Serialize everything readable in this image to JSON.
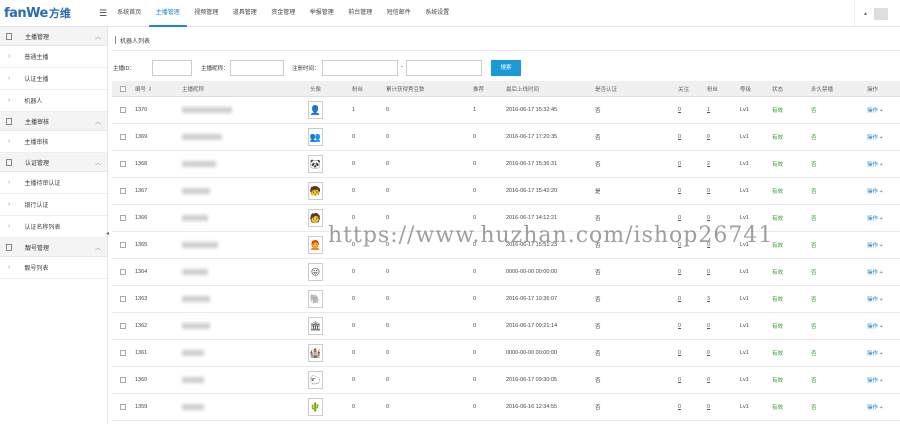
{
  "logo": {
    "brand": "fanWe",
    "brand_cn": "方维"
  },
  "menu_toggle": "☰",
  "topnav": [
    {
      "label": "系统首页",
      "active": false
    },
    {
      "label": "主播管理",
      "active": true
    },
    {
      "label": "视频管理",
      "active": false
    },
    {
      "label": "道具管理",
      "active": false
    },
    {
      "label": "资金管理",
      "active": false
    },
    {
      "label": "举报管理",
      "active": false
    },
    {
      "label": "前台管理",
      "active": false
    },
    {
      "label": "短信邮件",
      "active": false
    },
    {
      "label": "系统设置",
      "active": false
    }
  ],
  "top_right": {
    "caret": "▲"
  },
  "sidebar": {
    "groups": [
      {
        "label": "主播管理",
        "chevron": "︿",
        "items": [
          "普通主播",
          "认证主播",
          "机器人"
        ]
      },
      {
        "label": "主播审核",
        "chevron": "︿",
        "items": [
          "主播审核"
        ]
      },
      {
        "label": "认证管理",
        "chevron": "︿",
        "items": [
          "主播待审认证",
          "银行认证",
          "认证名称列表"
        ]
      },
      {
        "label": "靓号管理",
        "chevron": "︿",
        "items": [
          "靓号列表"
        ]
      }
    ],
    "collapse": "◂"
  },
  "breadcrumb": "机器人列表",
  "search": {
    "host_id_label": "主播ID：",
    "host_name_label": "主播昵称：",
    "reg_time_label": "注册时间：",
    "dash": "-",
    "button": "搜索"
  },
  "table": {
    "headers": [
      "编号 ⇩",
      "主播昵称",
      "头像",
      "粉丝",
      "累计获得秀豆数",
      "推荐",
      "最后上线时间",
      "是否认证",
      "关注",
      "粉丝",
      "等级",
      "状态",
      "永久禁播",
      "操作"
    ],
    "rows": [
      {
        "id": "1370",
        "name_w": 50,
        "avatar": "👤",
        "fans": "1",
        "beans": "0",
        "rec": "1",
        "last": "2016-06-17 15:32:45",
        "cert": "否",
        "follow": "0",
        "fans2": "1",
        "level": "Lv1",
        "status": "有效",
        "ban": "否",
        "op": "操作 +"
      },
      {
        "id": "1369",
        "name_w": 40,
        "avatar": "👥",
        "fans": "0",
        "beans": "0",
        "rec": "0",
        "last": "2016-06-17 17:20:35",
        "cert": "否",
        "follow": "0",
        "fans2": "0",
        "level": "Lv1",
        "status": "有效",
        "ban": "否",
        "op": "操作 +"
      },
      {
        "id": "1368",
        "name_w": 34,
        "avatar": "🐼",
        "fans": "0",
        "beans": "0",
        "rec": "0",
        "last": "2016-06-17 15:36:31",
        "cert": "否",
        "follow": "0",
        "fans2": "2",
        "level": "Lv1",
        "status": "有效",
        "ban": "否",
        "op": "操作 +"
      },
      {
        "id": "1367",
        "name_w": 28,
        "avatar": "🧒",
        "fans": "0",
        "beans": "0",
        "rec": "0",
        "last": "2016-06-17 15:42:20",
        "cert": "是",
        "follow": "0",
        "fans2": "0",
        "level": "Lv1",
        "status": "有效",
        "ban": "否",
        "op": "操作 +"
      },
      {
        "id": "1366",
        "name_w": 26,
        "avatar": "🧑",
        "fans": "0",
        "beans": "0",
        "rec": "0",
        "last": "2016-06-17 14:12:21",
        "cert": "否",
        "follow": "0",
        "fans2": "0",
        "level": "Lv1",
        "status": "有效",
        "ban": "否",
        "op": "操作 +"
      },
      {
        "id": "1365",
        "name_w": 36,
        "avatar": "🧑‍🦰",
        "fans": "0",
        "beans": "0",
        "rec": "0",
        "last": "2016-06-17 15:51:23",
        "cert": "否",
        "follow": "0",
        "fans2": "0",
        "level": "Lv1",
        "status": "有效",
        "ban": "否",
        "op": "操作 +"
      },
      {
        "id": "1364",
        "name_w": 26,
        "avatar": "😜",
        "fans": "0",
        "beans": "0",
        "rec": "0",
        "last": "0000-00-00 00:00:00",
        "cert": "否",
        "follow": "0",
        "fans2": "0",
        "level": "Lv1",
        "status": "有效",
        "ban": "否",
        "op": "操作 +"
      },
      {
        "id": "1363",
        "name_w": 28,
        "avatar": "🐘",
        "fans": "0",
        "beans": "0",
        "rec": "0",
        "last": "2016-06-17 10:36:07",
        "cert": "否",
        "follow": "0",
        "fans2": "3",
        "level": "Lv1",
        "status": "有效",
        "ban": "否",
        "op": "操作 +"
      },
      {
        "id": "1362",
        "name_w": 28,
        "avatar": "🏛",
        "fans": "0",
        "beans": "0",
        "rec": "0",
        "last": "2016-06-17 09:21:14",
        "cert": "否",
        "follow": "0",
        "fans2": "0",
        "level": "Lv1",
        "status": "有效",
        "ban": "否",
        "op": "操作 +"
      },
      {
        "id": "1361",
        "name_w": 22,
        "avatar": "🏰",
        "fans": "0",
        "beans": "0",
        "rec": "0",
        "last": "0000-00-00 00:00:00",
        "cert": "否",
        "follow": "0",
        "fans2": "0",
        "level": "Lv1",
        "status": "有效",
        "ban": "否",
        "op": "操作 +"
      },
      {
        "id": "1360",
        "name_w": 22,
        "avatar": "🐑",
        "fans": "0",
        "beans": "0",
        "rec": "0",
        "last": "2016-06-17 09:30:05",
        "cert": "否",
        "follow": "0",
        "fans2": "0",
        "level": "Lv1",
        "status": "有效",
        "ban": "否",
        "op": "操作 +"
      },
      {
        "id": "1359",
        "name_w": 22,
        "avatar": "🌵",
        "fans": "0",
        "beans": "0",
        "rec": "0",
        "last": "2016-06-16 12:34:55",
        "cert": "否",
        "follow": "0",
        "fans2": "0",
        "level": "Lv1",
        "status": "有效",
        "ban": "否",
        "op": "操作 +"
      }
    ]
  },
  "watermark": "https://www.huzhan.com/ishop26741",
  "colors": {
    "accent": "#1a8ad1",
    "button": "#1a9ad6",
    "status_green": "#2c9a2c"
  }
}
